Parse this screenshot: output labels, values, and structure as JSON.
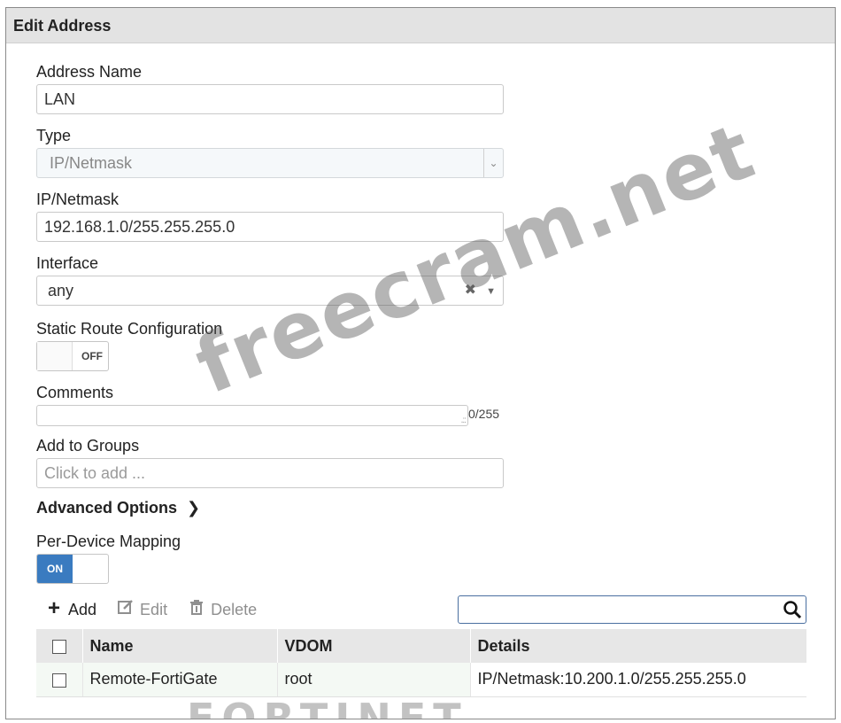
{
  "window": {
    "title": "Edit Address"
  },
  "form": {
    "address_name": {
      "label": "Address Name",
      "value": "LAN"
    },
    "type": {
      "label": "Type",
      "value": "IP/Netmask"
    },
    "ip_netmask": {
      "label": "IP/Netmask",
      "value": "192.168.1.0/255.255.255.0"
    },
    "interface": {
      "label": "Interface",
      "value": "any"
    },
    "static_route": {
      "label": "Static Route Configuration",
      "state": "OFF"
    },
    "comments": {
      "label": "Comments",
      "value": "",
      "counter": "0/255"
    },
    "groups": {
      "label": "Add to Groups",
      "placeholder": "Click to add ..."
    },
    "advanced": {
      "label": "Advanced Options"
    },
    "per_device": {
      "label": "Per-Device Mapping",
      "state": "ON"
    }
  },
  "toolbar": {
    "add": "Add",
    "edit": "Edit",
    "delete": "Delete",
    "search_value": ""
  },
  "table": {
    "columns": [
      "Name",
      "VDOM",
      "Details"
    ],
    "rows": [
      {
        "name": "Remote-FortiGate",
        "vdom": "root",
        "details": "IP/Netmask:10.200.1.0/255.255.255.0"
      }
    ]
  },
  "watermark": "freecram.net",
  "footer_logo": "FORTINET",
  "colors": {
    "toggle_on": "#3a7bc0",
    "header_bg": "#e3e3e3",
    "search_border": "#4a6fa0"
  }
}
